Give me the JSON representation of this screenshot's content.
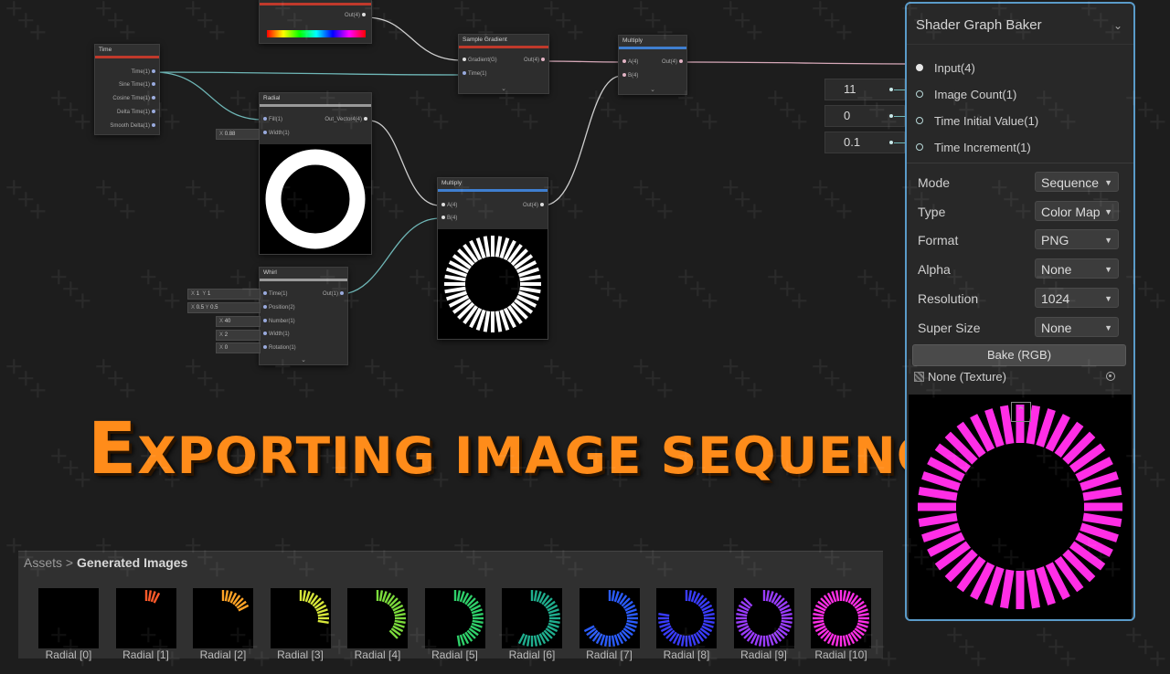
{
  "graph": {
    "time_node": {
      "title": "Time",
      "ports": [
        "Time(1)",
        "Sine Time(1)",
        "Cosine Time(1)",
        "Delta Time(1)",
        "Smooth Delta(1)"
      ]
    },
    "gradient_node": {
      "out": "Out(4)"
    },
    "sample_gradient": {
      "title": "Sample Gradient",
      "in1": "Gradient(G)",
      "in2": "Time(1)",
      "out": "Out(4)"
    },
    "multiply_top": {
      "title": "Multiply",
      "in1": "A(4)",
      "in2": "B(4)",
      "out": "Out(4)"
    },
    "radial": {
      "title": "Radial",
      "in1": "Fill(1)",
      "in2": "Width(1)",
      "out": "Out_Vector4(4)",
      "width_x": "X",
      "width_val": "0.88"
    },
    "multiply_mid": {
      "title": "Multiply",
      "in1": "A(4)",
      "in2": "B(4)",
      "out": "Out(4)"
    },
    "whirl": {
      "title": "Whirl",
      "ports": [
        "Time(1)",
        "Position(2)",
        "Number(1)",
        "Width(1)",
        "Rotation(1)"
      ],
      "out": "Out(1)",
      "inputs": [
        {
          "a": "X",
          "av": "1",
          "b": "Y",
          "bv": "1"
        },
        {
          "a": "X",
          "av": "0.5",
          "b": "Y",
          "bv": "0.5"
        },
        {
          "a": "X",
          "av": "40"
        },
        {
          "a": "X",
          "av": "2"
        },
        {
          "a": "X",
          "av": "0"
        }
      ]
    }
  },
  "headline": {
    "first": "E",
    "rest": "xporting image sequences"
  },
  "baker": {
    "title": "Shader Graph Baker",
    "pins": [
      {
        "label": "Input(4)"
      },
      {
        "label": "Image Count(1)",
        "value": "11"
      },
      {
        "label": "Time Initial Value(1)",
        "value": "0"
      },
      {
        "label": "Time Increment(1)",
        "value": "0.1"
      }
    ],
    "props": [
      {
        "label": "Mode",
        "value": "Sequence"
      },
      {
        "label": "Type",
        "value": "Color Map"
      },
      {
        "label": "Format",
        "value": "PNG"
      },
      {
        "label": "Alpha",
        "value": "None"
      },
      {
        "label": "Resolution",
        "value": "1024"
      },
      {
        "label": "Super Size",
        "value": "None"
      }
    ],
    "bake_label": "Bake (RGB)",
    "texture_label": "None (Texture)",
    "preview_color": "#ff2ee6"
  },
  "assets": {
    "root": "Assets",
    "separator": ">",
    "folder": "Generated Images",
    "items": [
      {
        "name": "Radial [0]",
        "fill": 0.0,
        "color": "#ff4422"
      },
      {
        "name": "Radial [1]",
        "fill": 0.1,
        "color": "#ff5a2a"
      },
      {
        "name": "Radial [2]",
        "fill": 0.2,
        "color": "#ffa326"
      },
      {
        "name": "Radial [3]",
        "fill": 0.3,
        "color": "#d8e83a"
      },
      {
        "name": "Radial [4]",
        "fill": 0.4,
        "color": "#7cdc3c"
      },
      {
        "name": "Radial [5]",
        "fill": 0.5,
        "color": "#2fd06a"
      },
      {
        "name": "Radial [6]",
        "fill": 0.6,
        "color": "#1fae8e"
      },
      {
        "name": "Radial [7]",
        "fill": 0.7,
        "color": "#2a5cff"
      },
      {
        "name": "Radial [8]",
        "fill": 0.8,
        "color": "#3a3cff"
      },
      {
        "name": "Radial [9]",
        "fill": 0.9,
        "color": "#9a3cff"
      },
      {
        "name": "Radial [10]",
        "fill": 1.0,
        "color": "#ff2ee6"
      }
    ]
  }
}
